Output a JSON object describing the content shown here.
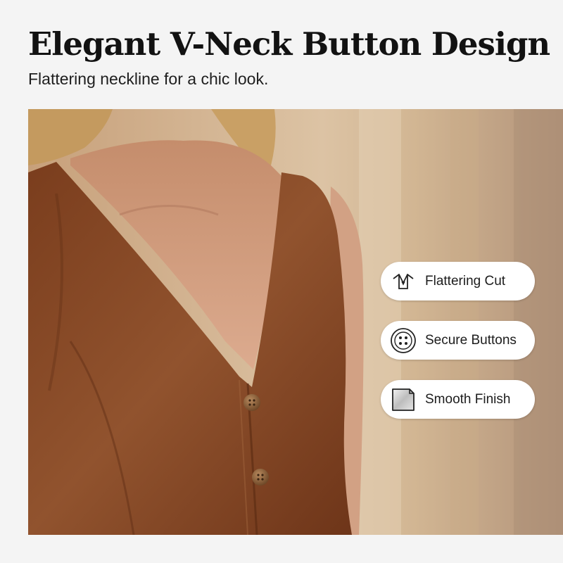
{
  "header": {
    "title": "Elegant V-Neck Button Design",
    "subtitle": "Flattering neckline for a chic look."
  },
  "features": [
    {
      "label": "Flattering Cut",
      "icon": "v-neck-shirt-icon"
    },
    {
      "label": "Secure Buttons",
      "icon": "button-icon"
    },
    {
      "label": "Smooth Finish",
      "icon": "fabric-swatch-icon"
    }
  ],
  "colors": {
    "page_background": "#f4f4f4",
    "garment": "#8a4a26",
    "skin": "#d9a78a",
    "pill_background": "#ffffff",
    "text": "#121212"
  }
}
